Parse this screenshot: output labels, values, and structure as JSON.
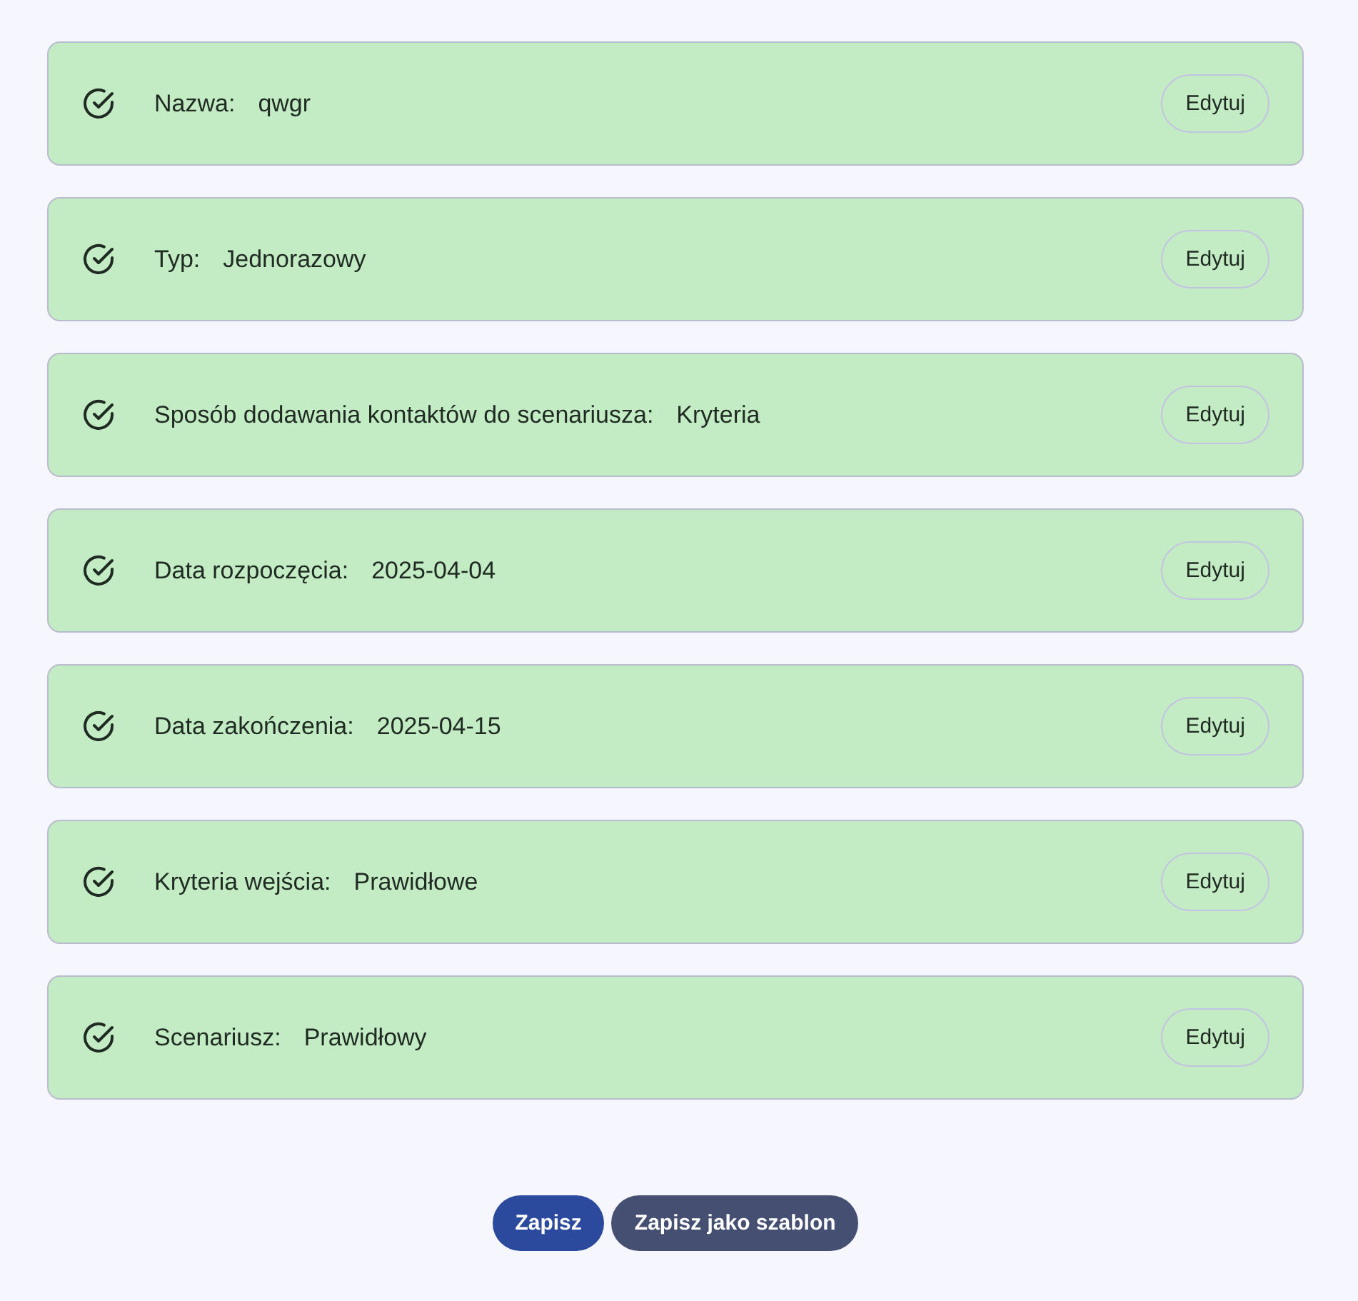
{
  "steps": [
    {
      "label": "Nazwa:",
      "value": "qwgr",
      "completed": true,
      "action": "Edytuj"
    },
    {
      "label": "Typ:",
      "value": "Jednorazowy",
      "completed": true,
      "action": "Edytuj"
    },
    {
      "label": "Sposób dodawania kontaktów do scenariusza:",
      "value": "Kryteria",
      "completed": true,
      "action": "Edytuj"
    },
    {
      "label": "Data rozpoczęcia:",
      "value": "2025-04-04",
      "completed": true,
      "action": "Edytuj"
    },
    {
      "label": "Data zakończenia:",
      "value": "2025-04-15",
      "completed": true,
      "action": "Edytuj"
    },
    {
      "label": "Kryteria wejścia:",
      "value": "Prawidłowe",
      "completed": true,
      "action": "Edytuj"
    },
    {
      "label": "Scenariusz:",
      "value": "Prawidłowy",
      "completed": true,
      "action": "Edytuj"
    }
  ],
  "footer_buttons": [
    {
      "label": "Zapisz",
      "kind": "primary"
    },
    {
      "label": "Zapisz jako szablon",
      "kind": "secondary"
    }
  ]
}
